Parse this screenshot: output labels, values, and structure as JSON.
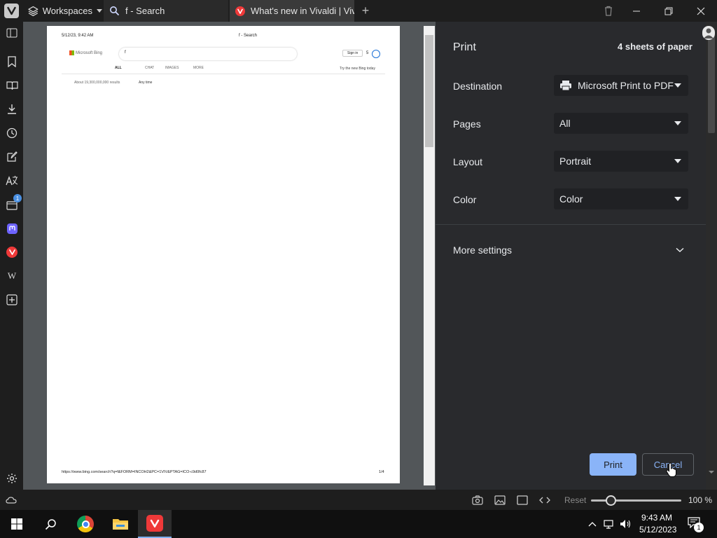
{
  "tabs": {
    "workspaces_label": "Workspaces",
    "tab1_label": "f - Search",
    "tab2_label": "What's new in Vivaldi | Viva",
    "new_tab_symbol": "+"
  },
  "preview": {
    "header_date": "5/12/23, 9:42 AM",
    "header_title": "f - Search",
    "bing_logo_text": "Microsoft Bing",
    "search_query": "f",
    "sign_in": "Sign in",
    "score": "5",
    "nav_all": "ALL",
    "nav_chat": "CHAT",
    "nav_images": "IMAGES",
    "nav_more": "MORE",
    "try_bing": "Try the new Bing today",
    "results_count": "About 19,300,000,000 results",
    "any_time": "Any time",
    "footer_url": "https://www.bing.com/search?q=f&FORM=INCOH2&PC=1VIV&PTAG=ICO-c9d0fc87",
    "footer_page": "1/4"
  },
  "print": {
    "title": "Print",
    "sheets": "4 sheets of paper",
    "destination_label": "Destination",
    "destination_value": "Microsoft Print to PDF",
    "pages_label": "Pages",
    "pages_value": "All",
    "layout_label": "Layout",
    "layout_value": "Portrait",
    "color_label": "Color",
    "color_value": "Color",
    "more_settings": "More settings",
    "print_button": "Print",
    "cancel_button": "Cancel"
  },
  "statusbar": {
    "reset": "Reset",
    "zoom": "100 %",
    "zoom_fraction": 0.22
  },
  "taskbar": {
    "time": "9:43 AM",
    "date": "5/12/2023",
    "notification_count": "1"
  },
  "sidebar": {
    "mail_badge": "1"
  },
  "colors": {
    "print_button_bg": "#8ab4f8",
    "accent_red": "#ef3939"
  }
}
